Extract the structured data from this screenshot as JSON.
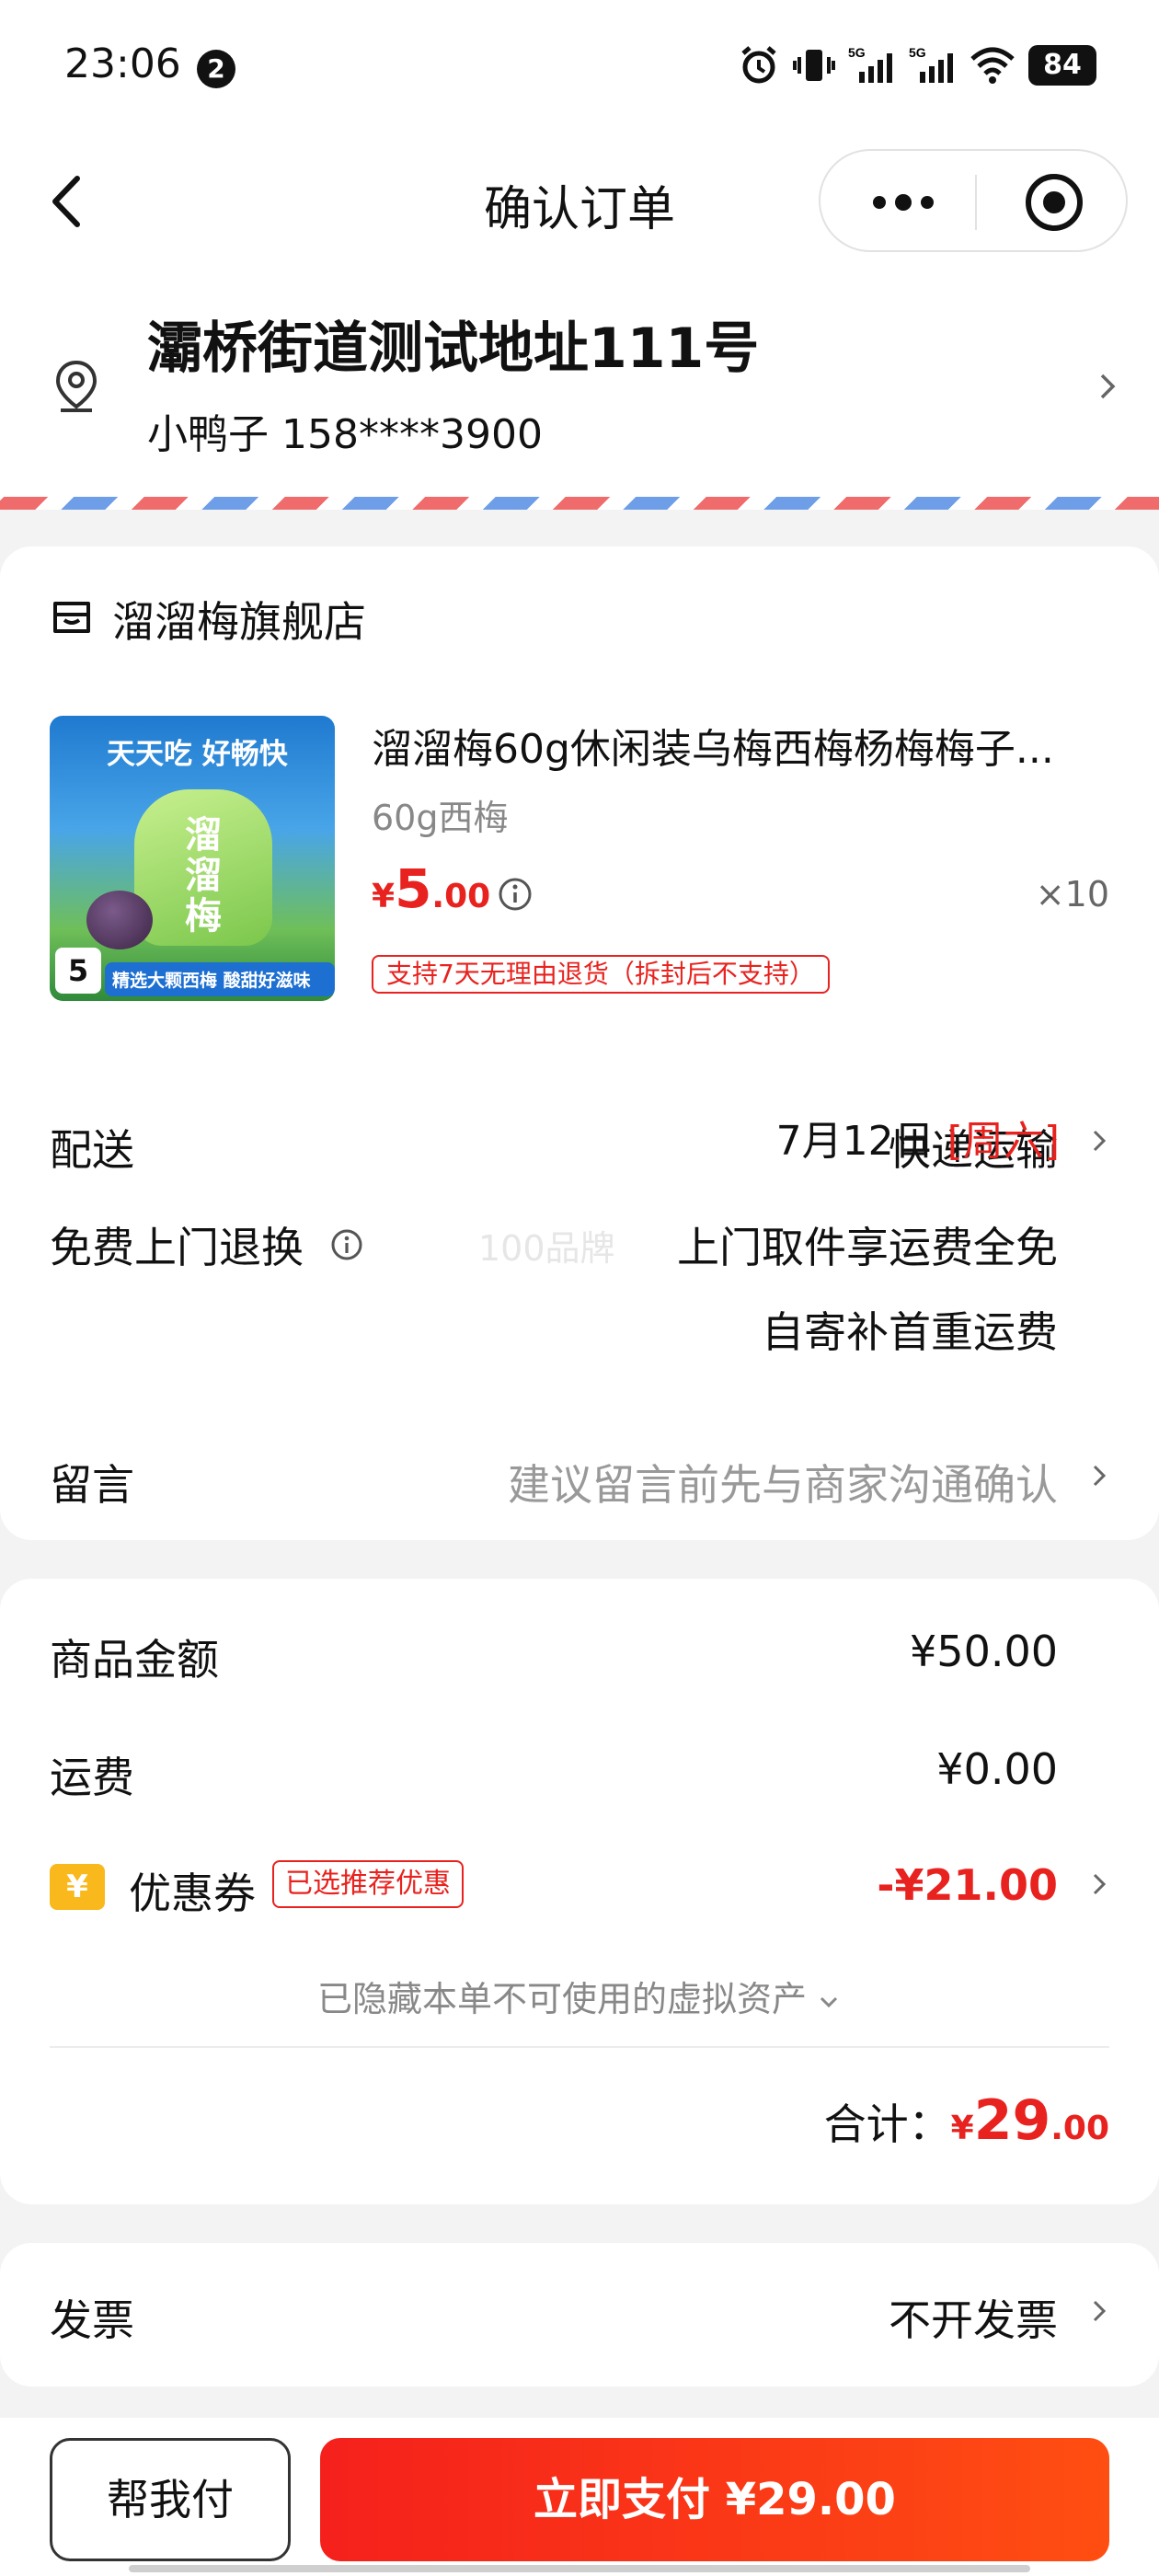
{
  "status_bar": {
    "time": "23:06",
    "notification_count": "2",
    "signal_label_1": "5G",
    "signal_label_2": "5G",
    "battery": "84"
  },
  "nav": {
    "title": "确认订单"
  },
  "address": {
    "title": "灞桥街道测试地址111号",
    "contact": "小鸭子 158****3900"
  },
  "shop": {
    "name": "溜溜梅旗舰店"
  },
  "product": {
    "title": "溜溜梅60g休闲装乌梅西梅杨梅梅子...",
    "spec": "60g西梅",
    "price_symbol": "¥",
    "price_int": "5",
    "price_dec": ".00",
    "quantity": "×10",
    "return_policy": "支持7天无理由退货（拆封后不支持）",
    "image": {
      "banner": "天天吃 好畅快",
      "brand": "溜溜梅",
      "price_tag": "5",
      "caption": "精选大颗西梅 酸甜好滋味"
    }
  },
  "delivery": {
    "label": "配送",
    "method": "快递运输",
    "date": "7月12日",
    "weekday": "[周六]"
  },
  "free_return": {
    "label": "免费上门退换",
    "watermark": "100品牌",
    "line1": "上门取件享运费全免",
    "line2": "自寄补首重运费"
  },
  "note": {
    "label": "留言",
    "placeholder": "建议留言前先与商家沟通确认"
  },
  "pricing": {
    "goods_label": "商品金额",
    "goods_value": "¥50.00",
    "shipping_label": "运费",
    "shipping_value": "¥0.00",
    "coupon_label": "优惠券",
    "coupon_icon": "¥",
    "coupon_tag": "已选推荐优惠",
    "coupon_value": "-¥21.00",
    "hidden_assets": "已隐藏本单不可使用的虚拟资产",
    "total_label": "合计：",
    "total_symbol": "¥",
    "total_int": "29",
    "total_dec": ".00"
  },
  "invoice": {
    "label": "发票",
    "value": "不开发票"
  },
  "bottom": {
    "help_pay": "帮我付",
    "pay_now": "立即支付 ¥29.00"
  },
  "colors": {
    "accent": "#e8221e",
    "coupon_icon": "#f9b81b",
    "background": "#f3f3f3"
  }
}
